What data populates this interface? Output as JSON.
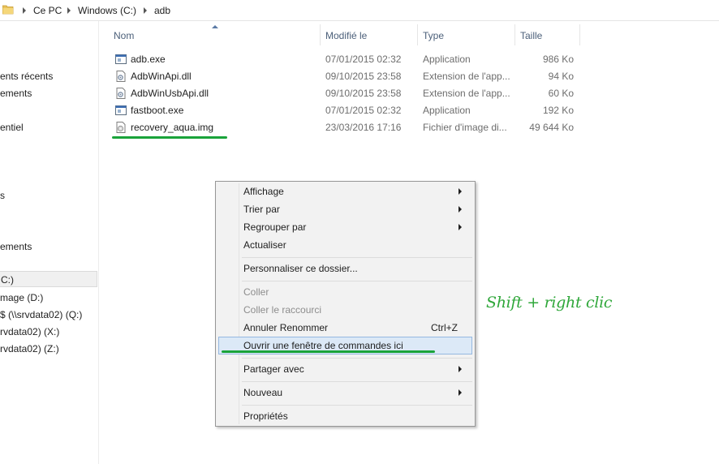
{
  "breadcrumb": {
    "items": [
      "Ce PC",
      "Windows (C:)",
      "adb"
    ]
  },
  "sidebar": {
    "items": [
      "ents récents",
      "ements",
      "entiel",
      "s",
      "ements",
      "C:)",
      "mage (D:)",
      "$ (\\\\srvdata02) (Q:)",
      "rvdata02) (X:)",
      "rvdata02) (Z:)"
    ],
    "selected_index": 5
  },
  "columns": {
    "name": "Nom",
    "modified": "Modifié le",
    "type": "Type",
    "size": "Taille"
  },
  "files": [
    {
      "name": "adb.exe",
      "modified": "07/01/2015 02:32",
      "type": "Application",
      "size": "986 Ko",
      "icon": "exe-icon"
    },
    {
      "name": "AdbWinApi.dll",
      "modified": "09/10/2015 23:58",
      "type": "Extension de l'app...",
      "size": "94 Ko",
      "icon": "dll-icon"
    },
    {
      "name": "AdbWinUsbApi.dll",
      "modified": "09/10/2015 23:58",
      "type": "Extension de l'app...",
      "size": "60 Ko",
      "icon": "dll-icon"
    },
    {
      "name": "fastboot.exe",
      "modified": "07/01/2015 02:32",
      "type": "Application",
      "size": "192 Ko",
      "icon": "exe-icon"
    },
    {
      "name": "recovery_aqua.img",
      "modified": "23/03/2016 17:16",
      "type": "Fichier d'image di...",
      "size": "49 644 Ko",
      "icon": "disc-image-icon"
    }
  ],
  "context_menu": {
    "items": [
      {
        "label": "Affichage",
        "submenu": true
      },
      {
        "label": "Trier par",
        "submenu": true
      },
      {
        "label": "Regrouper par",
        "submenu": true
      },
      {
        "label": "Actualiser"
      },
      {
        "label": "Personnaliser ce dossier..."
      },
      {
        "label": "Coller",
        "disabled": true
      },
      {
        "label": "Coller le raccourci",
        "disabled": true
      },
      {
        "label": "Annuler Renommer",
        "shortcut": "Ctrl+Z"
      },
      {
        "label": "Ouvrir une fenêtre de commandes ici",
        "highlighted": true
      },
      {
        "label": "Partager avec",
        "submenu": true
      },
      {
        "label": "Nouveau",
        "submenu": true
      },
      {
        "label": "Propriétés"
      }
    ]
  },
  "annotation": {
    "text": "Shift + right clic",
    "color": "#2fa73a"
  }
}
